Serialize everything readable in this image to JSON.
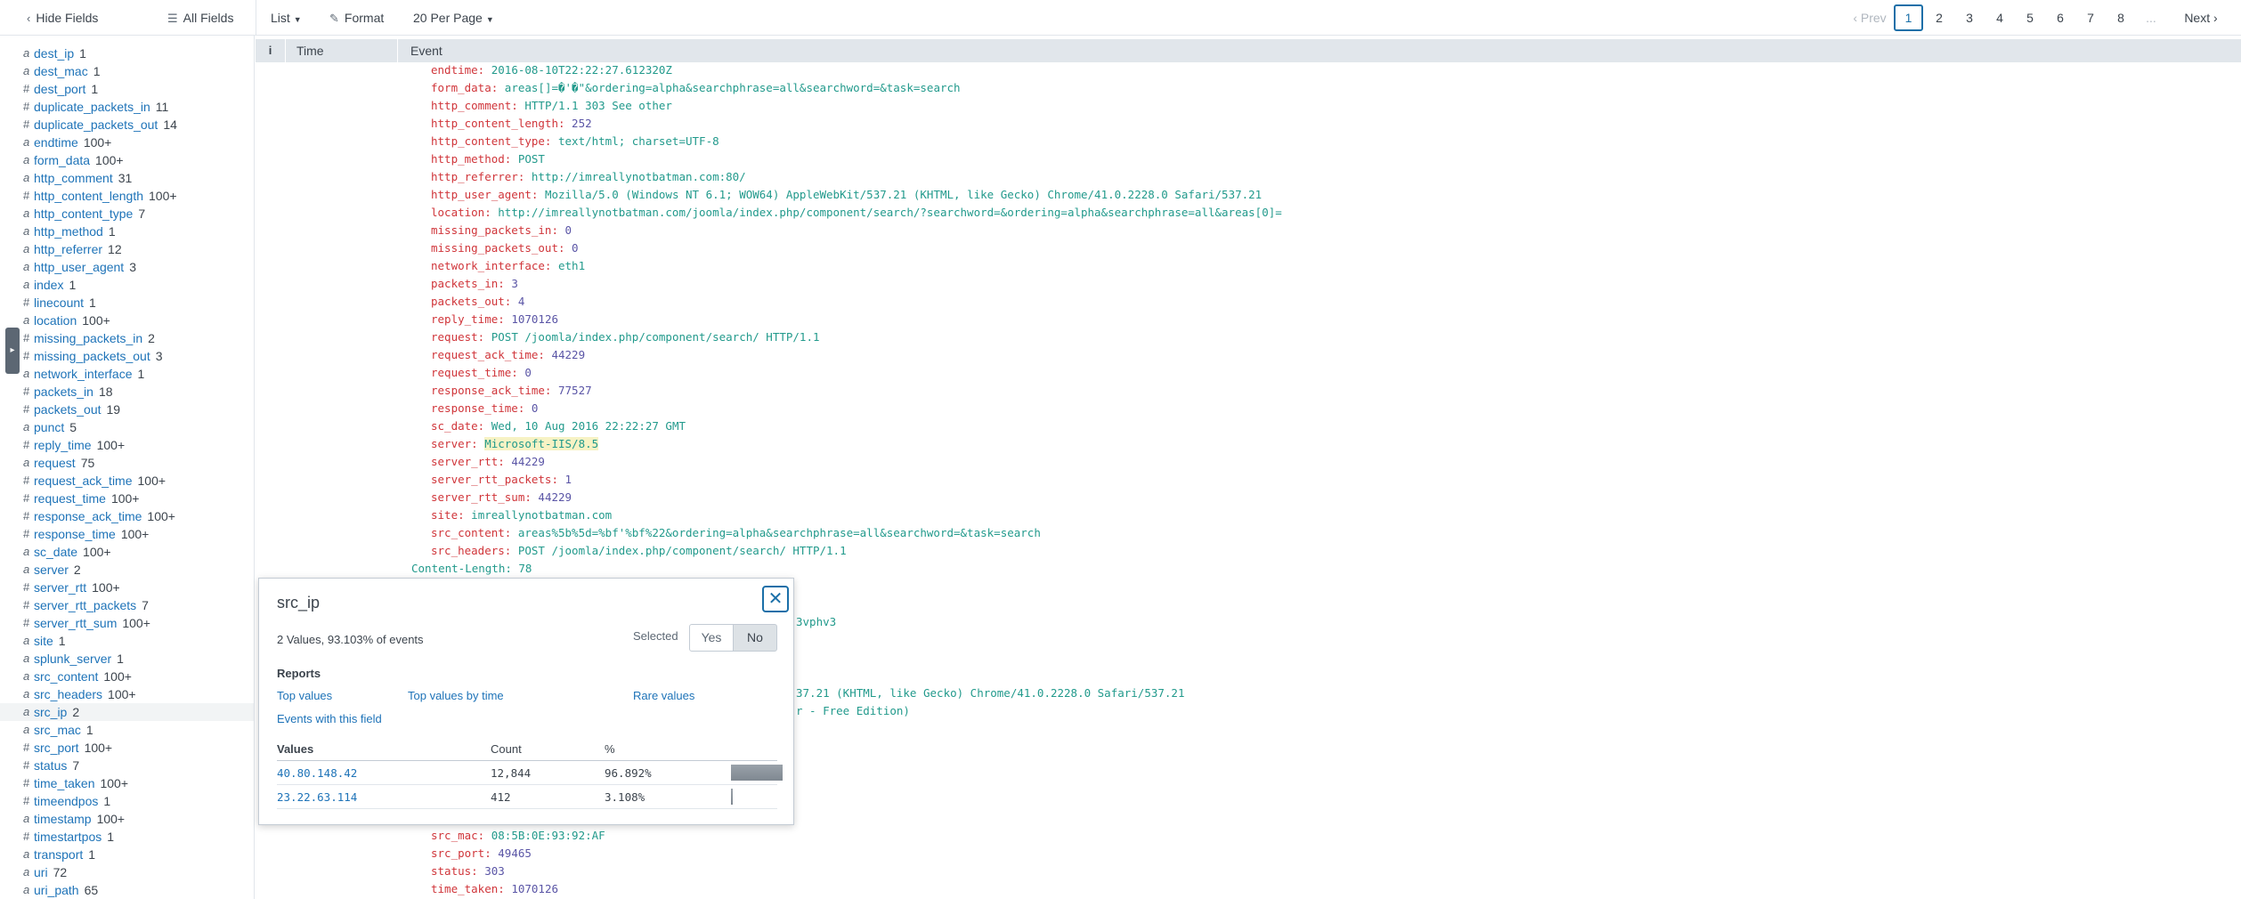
{
  "toolbar": {
    "hide_fields": "Hide Fields",
    "all_fields": "All Fields",
    "list": "List",
    "format": "Format",
    "per_page": "20 Per Page"
  },
  "pagination": {
    "prev": "Prev",
    "pages": [
      "1",
      "2",
      "3",
      "4",
      "5",
      "6",
      "7",
      "8"
    ],
    "current": "1",
    "ellipsis": "...",
    "next": "Next"
  },
  "sidebar": {
    "fields": [
      {
        "type": "a",
        "name": "dest_ip",
        "count": "1"
      },
      {
        "type": "a",
        "name": "dest_mac",
        "count": "1"
      },
      {
        "type": "#",
        "name": "dest_port",
        "count": "1"
      },
      {
        "type": "#",
        "name": "duplicate_packets_in",
        "count": "11"
      },
      {
        "type": "#",
        "name": "duplicate_packets_out",
        "count": "14"
      },
      {
        "type": "a",
        "name": "endtime",
        "count": "100+"
      },
      {
        "type": "a",
        "name": "form_data",
        "count": "100+"
      },
      {
        "type": "a",
        "name": "http_comment",
        "count": "31"
      },
      {
        "type": "#",
        "name": "http_content_length",
        "count": "100+"
      },
      {
        "type": "a",
        "name": "http_content_type",
        "count": "7"
      },
      {
        "type": "a",
        "name": "http_method",
        "count": "1"
      },
      {
        "type": "a",
        "name": "http_referrer",
        "count": "12"
      },
      {
        "type": "a",
        "name": "http_user_agent",
        "count": "3"
      },
      {
        "type": "a",
        "name": "index",
        "count": "1"
      },
      {
        "type": "#",
        "name": "linecount",
        "count": "1"
      },
      {
        "type": "a",
        "name": "location",
        "count": "100+"
      },
      {
        "type": "#",
        "name": "missing_packets_in",
        "count": "2"
      },
      {
        "type": "#",
        "name": "missing_packets_out",
        "count": "3"
      },
      {
        "type": "a",
        "name": "network_interface",
        "count": "1"
      },
      {
        "type": "#",
        "name": "packets_in",
        "count": "18"
      },
      {
        "type": "#",
        "name": "packets_out",
        "count": "19"
      },
      {
        "type": "a",
        "name": "punct",
        "count": "5"
      },
      {
        "type": "#",
        "name": "reply_time",
        "count": "100+"
      },
      {
        "type": "a",
        "name": "request",
        "count": "75"
      },
      {
        "type": "#",
        "name": "request_ack_time",
        "count": "100+"
      },
      {
        "type": "#",
        "name": "request_time",
        "count": "100+"
      },
      {
        "type": "#",
        "name": "response_ack_time",
        "count": "100+"
      },
      {
        "type": "#",
        "name": "response_time",
        "count": "100+"
      },
      {
        "type": "a",
        "name": "sc_date",
        "count": "100+"
      },
      {
        "type": "a",
        "name": "server",
        "count": "2"
      },
      {
        "type": "#",
        "name": "server_rtt",
        "count": "100+"
      },
      {
        "type": "#",
        "name": "server_rtt_packets",
        "count": "7"
      },
      {
        "type": "#",
        "name": "server_rtt_sum",
        "count": "100+"
      },
      {
        "type": "a",
        "name": "site",
        "count": "1"
      },
      {
        "type": "a",
        "name": "splunk_server",
        "count": "1"
      },
      {
        "type": "a",
        "name": "src_content",
        "count": "100+"
      },
      {
        "type": "a",
        "name": "src_headers",
        "count": "100+"
      },
      {
        "type": "a",
        "name": "src_ip",
        "count": "2"
      },
      {
        "type": "a",
        "name": "src_mac",
        "count": "1"
      },
      {
        "type": "#",
        "name": "src_port",
        "count": "100+"
      },
      {
        "type": "#",
        "name": "status",
        "count": "7"
      },
      {
        "type": "#",
        "name": "time_taken",
        "count": "100+"
      },
      {
        "type": "#",
        "name": "timeendpos",
        "count": "1"
      },
      {
        "type": "a",
        "name": "timestamp",
        "count": "100+"
      },
      {
        "type": "#",
        "name": "timestartpos",
        "count": "1"
      },
      {
        "type": "a",
        "name": "transport",
        "count": "1"
      },
      {
        "type": "a",
        "name": "uri",
        "count": "72"
      },
      {
        "type": "a",
        "name": "uri_path",
        "count": "65"
      }
    ],
    "selected_field": "src_ip"
  },
  "results_header": {
    "info": "i",
    "time": "Time",
    "event": "Event"
  },
  "event_lines": [
    {
      "key": "endtime:",
      "value": "2016-08-10T22:22:27.612320Z",
      "kind": "str"
    },
    {
      "key": "form_data:",
      "value": "areas[]=�'�\"&ordering=alpha&searchphrase=all&searchword=&task=search",
      "kind": "str"
    },
    {
      "key": "http_comment:",
      "value": "HTTP/1.1 303 See other",
      "kind": "str"
    },
    {
      "key": "http_content_length:",
      "value": "252",
      "kind": "num"
    },
    {
      "key": "http_content_type:",
      "value": "text/html; charset=UTF-8",
      "kind": "str"
    },
    {
      "key": "http_method:",
      "value": "POST",
      "kind": "str"
    },
    {
      "key": "http_referrer:",
      "value": "http://imreallynotbatman.com:80/",
      "kind": "str"
    },
    {
      "key": "http_user_agent:",
      "value": "Mozilla/5.0 (Windows NT 6.1; WOW64) AppleWebKit/537.21 (KHTML, like Gecko) Chrome/41.0.2228.0 Safari/537.21",
      "kind": "str"
    },
    {
      "key": "location:",
      "value": "http://imreallynotbatman.com/joomla/index.php/component/search/?searchword=&ordering=alpha&searchphrase=all&areas[0]=",
      "kind": "str"
    },
    {
      "key": "missing_packets_in:",
      "value": "0",
      "kind": "num"
    },
    {
      "key": "missing_packets_out:",
      "value": "0",
      "kind": "num"
    },
    {
      "key": "network_interface:",
      "value": "eth1",
      "kind": "str"
    },
    {
      "key": "packets_in:",
      "value": "3",
      "kind": "num"
    },
    {
      "key": "packets_out:",
      "value": "4",
      "kind": "num"
    },
    {
      "key": "reply_time:",
      "value": "1070126",
      "kind": "num"
    },
    {
      "key": "request:",
      "value": "POST /joomla/index.php/component/search/ HTTP/1.1",
      "kind": "str"
    },
    {
      "key": "request_ack_time:",
      "value": "44229",
      "kind": "num"
    },
    {
      "key": "request_time:",
      "value": "0",
      "kind": "num"
    },
    {
      "key": "response_ack_time:",
      "value": "77527",
      "kind": "num"
    },
    {
      "key": "response_time:",
      "value": "0",
      "kind": "num"
    },
    {
      "key": "sc_date:",
      "value": "Wed, 10 Aug 2016 22:22:27 GMT",
      "kind": "str"
    },
    {
      "key": "server:",
      "value": "Microsoft-IIS/8.5",
      "kind": "hl"
    },
    {
      "key": "server_rtt:",
      "value": "44229",
      "kind": "num"
    },
    {
      "key": "server_rtt_packets:",
      "value": "1",
      "kind": "num"
    },
    {
      "key": "server_rtt_sum:",
      "value": "44229",
      "kind": "num"
    },
    {
      "key": "site:",
      "value": "imreallynotbatman.com",
      "kind": "str"
    },
    {
      "key": "src_content:",
      "value": "areas%5b%5d=%bf'%bf%22&ordering=alpha&searchphrase=all&searchword=&task=search",
      "kind": "str"
    },
    {
      "key": "src_headers:",
      "value": "POST /joomla/index.php/component/search/ HTTP/1.1",
      "kind": "str"
    }
  ],
  "event_plain_line": "Content-Length: 78",
  "event_fragments": [
    "3vphv3",
    "37.21 (KHTML, like Gecko) Chrome/41.0.2228.0 Safari/537.21",
    "r - Free Edition)"
  ],
  "event_lines_bottom": [
    {
      "key": "src_mac:",
      "value": "08:5B:0E:93:92:AF",
      "kind": "str"
    },
    {
      "key": "src_port:",
      "value": "49465",
      "kind": "num"
    },
    {
      "key": "status:",
      "value": "303",
      "kind": "num"
    },
    {
      "key": "time_taken:",
      "value": "1070126",
      "kind": "num"
    }
  ],
  "popup": {
    "title": "src_ip",
    "close_glyph": "✕",
    "summary": "2 Values, 93.103% of events",
    "selected_label": "Selected",
    "yes": "Yes",
    "no": "No",
    "reports_label": "Reports",
    "reports": [
      "Top values",
      "Top values by time",
      "Rare values"
    ],
    "events_link": "Events with this field",
    "table_headers": {
      "values": "Values",
      "count": "Count",
      "percent": "%"
    },
    "rows": [
      {
        "value": "40.80.148.42",
        "count": "12,844",
        "percent": "96.892%",
        "fraction": 0.96892
      },
      {
        "value": "23.22.63.114",
        "count": "412",
        "percent": "3.108%",
        "fraction": 0.03108
      }
    ]
  },
  "icons": {
    "hide_fields": "chevron-left-icon",
    "all_fields": "list-icon",
    "format": "pencil-icon",
    "close": "close-icon",
    "collapse": "sidebar-toggle-icon"
  },
  "colors": {
    "link": "#1e73b8",
    "event_key": "#d0353a",
    "event_value": "#229a8c",
    "event_number": "#5a55a6",
    "accent": "#1a6fa8"
  }
}
